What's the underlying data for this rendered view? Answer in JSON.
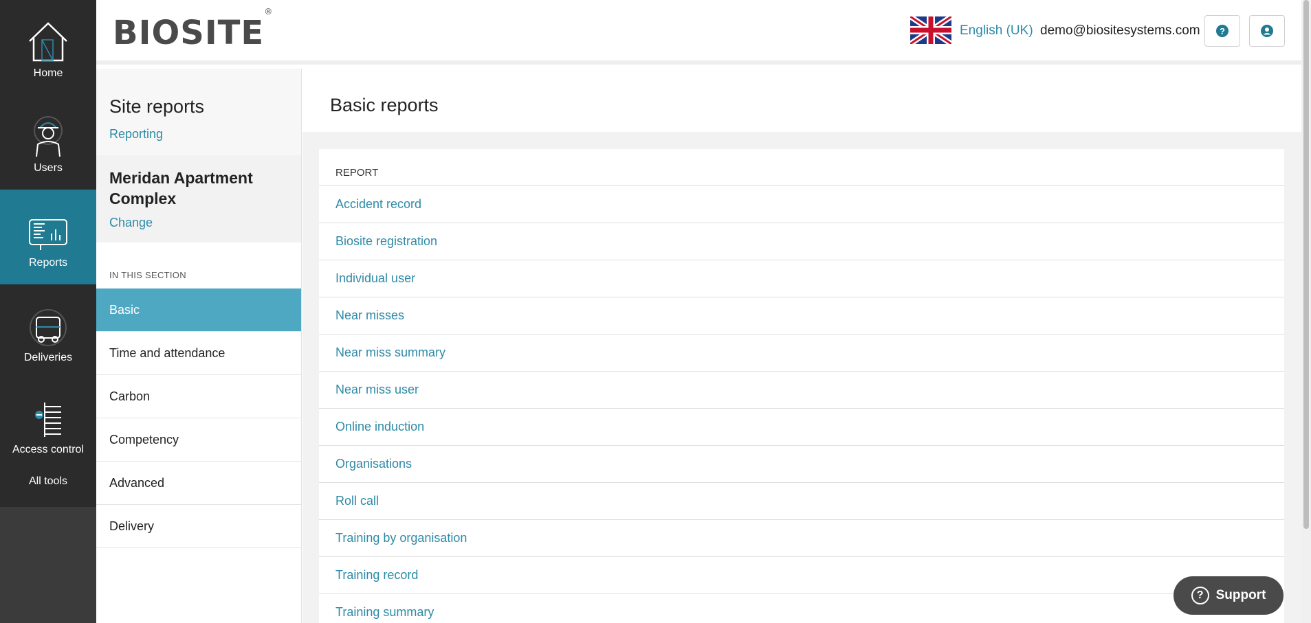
{
  "nav": {
    "items": [
      {
        "label": "Home",
        "icon": "house-icon"
      },
      {
        "label": "Users",
        "icon": "worker-icon"
      },
      {
        "label": "Reports",
        "icon": "report-chart-icon"
      },
      {
        "label": "Deliveries",
        "icon": "truck-icon"
      },
      {
        "label": "Access control",
        "icon": "turnstile-icon"
      }
    ],
    "all_tools": "All tools",
    "active_color": "#1f7a92"
  },
  "header": {
    "logo_text": "BIOSITE",
    "logo_mark": "®",
    "language": "English (UK)",
    "email": "demo@biositesystems.com",
    "help_icon": "help-circle-icon",
    "account_icon": "user-circle-icon"
  },
  "sidebar": {
    "title": "Site reports",
    "subtitle_link": "Reporting",
    "site_name": "Meridan Apartment Complex",
    "change_link": "Change",
    "section_label": "IN THIS SECTION",
    "items": [
      {
        "label": "Basic",
        "active": true
      },
      {
        "label": "Time and attendance"
      },
      {
        "label": "Carbon"
      },
      {
        "label": "Competency"
      },
      {
        "label": "Advanced"
      },
      {
        "label": "Delivery"
      }
    ]
  },
  "main": {
    "title": "Basic reports",
    "column_header": "REPORT",
    "reports": [
      "Accident record",
      "Biosite registration",
      "Individual user",
      "Near misses",
      "Near miss summary",
      "Near miss user",
      "Online induction",
      "Organisations",
      "Roll call",
      "Training by organisation",
      "Training record",
      "Training summary"
    ]
  },
  "support": {
    "label": "Support"
  },
  "colors": {
    "link": "#2e8aa7",
    "sidebar_active": "#4fa8c2"
  }
}
